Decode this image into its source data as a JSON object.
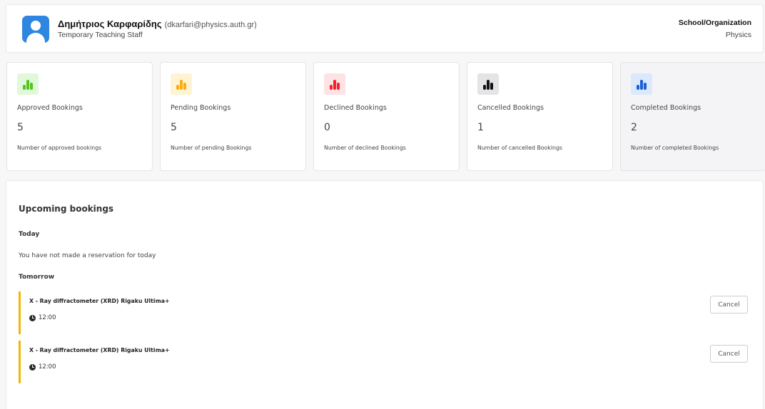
{
  "user": {
    "name": "Δημήτριος Καρφαρίδης",
    "email": "(dkarfari@physics.auth.gr)",
    "role": "Temporary Teaching Staff",
    "org_label": "School/Organization",
    "org_value": "Physics"
  },
  "stats": [
    {
      "label": "Approved Bookings",
      "value": "5",
      "description": "Number of approved bookings",
      "color": "#52c41a",
      "bg": "#e2f8da"
    },
    {
      "label": "Pending Bookings",
      "value": "5",
      "description": "Number of pending Bookings",
      "color": "#faad14",
      "bg": "#fff3d4"
    },
    {
      "label": "Declined Bookings",
      "value": "0",
      "description": "Number of declined Bookings",
      "color": "#f5222d",
      "bg": "#fde3e4"
    },
    {
      "label": "Cancelled Bookings",
      "value": "1",
      "description": "Number of cancelled Bookings",
      "color": "#111111",
      "bg": "#e4e4e6"
    },
    {
      "label": "Completed Bookings",
      "value": "2",
      "description": "Number of completed Bookings",
      "color": "#1a5fd6",
      "bg": "#dce8fb"
    }
  ],
  "upcoming": {
    "title": "Upcoming bookings",
    "today_label": "Today",
    "today_empty": "You have not made a reservation for today",
    "tomorrow_label": "Tomorrow",
    "items": [
      {
        "title": "X - Ray diffractometer (XRD) Rigaku Ultima+",
        "time": "12:00",
        "action": "Cancel"
      },
      {
        "title": "X - Ray diffractometer (XRD) Rigaku Ultima+",
        "time": "12:00",
        "action": "Cancel"
      }
    ]
  }
}
